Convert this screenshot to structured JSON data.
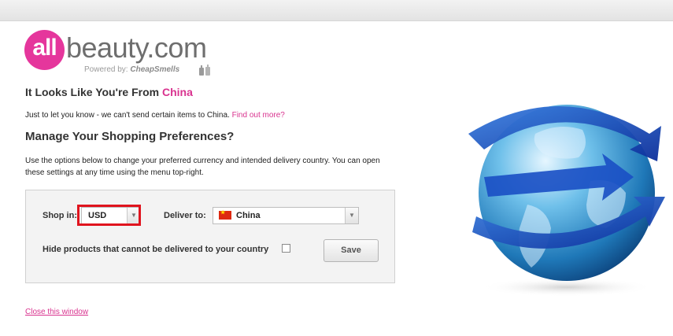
{
  "brand": {
    "logo_all": "all",
    "logo_rest": "beauty.com",
    "powered_prefix": "Powered by:",
    "powered_brand": "CheapSmells"
  },
  "heading": {
    "prefix": "It Looks Like You're From",
    "country": "China"
  },
  "notice": {
    "text": "Just to let you know - we can't send certain items to China.",
    "link": "Find out more?"
  },
  "manage": {
    "title": "Manage Your Shopping Preferences?",
    "description": "Use the options below to change your preferred currency and intended delivery country. You can open these settings at any time using the menu top-right."
  },
  "preferences": {
    "shop_in_label": "Shop in:",
    "currency_value": "USD",
    "deliver_to_label": "Deliver to:",
    "country_value": "China",
    "hide_products_label": "Hide products that cannot be delivered to your country",
    "hide_products_checked": false,
    "save_label": "Save"
  },
  "footer": {
    "close_link": "Close this window"
  },
  "colors": {
    "accent": "#d9338f",
    "logo_pink": "#e5369c",
    "highlight": "#e0141e"
  },
  "icons": [
    "dropdown-arrow-icon",
    "china-flag-icon",
    "perfume-bottles-icon",
    "globe-arrows-illustration"
  ]
}
